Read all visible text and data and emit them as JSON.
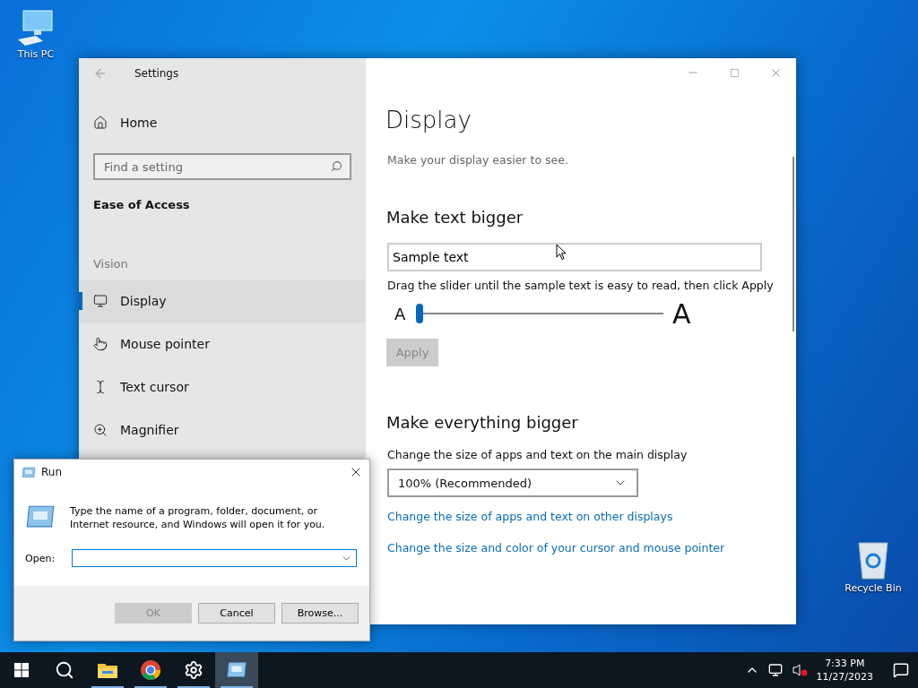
{
  "desktop_icons": [
    {
      "label": "This PC",
      "kind": "computer"
    },
    {
      "label": "Recycle Bin",
      "kind": "recycle"
    }
  ],
  "settings": {
    "title": "Settings",
    "home": "Home",
    "search": {
      "placeholder": "Find a setting"
    },
    "category": "Ease of Access",
    "group": "Vision",
    "nav": [
      {
        "label": "Display",
        "kind": "display",
        "selected": true
      },
      {
        "label": "Mouse pointer",
        "kind": "pointer",
        "selected": false
      },
      {
        "label": "Text cursor",
        "kind": "cursor",
        "selected": false
      },
      {
        "label": "Magnifier",
        "kind": "magnifier",
        "selected": false
      }
    ],
    "page": {
      "title": "Display",
      "subtitle": "Make your display easier to see.",
      "text_bigger": {
        "heading": "Make text bigger",
        "sample": "Sample text",
        "hint": "Drag the slider until the sample text is easy to read, then click Apply",
        "small_a": "A",
        "large_a": "A",
        "slider": {
          "level": 0
        },
        "apply": {
          "label": "Apply",
          "disabled": true
        }
      },
      "everything_bigger": {
        "heading": "Make everything bigger",
        "label": "Change the size of apps and text on the main display",
        "dropdown": "100% (Recommended)",
        "links": [
          "Change the size of apps and text on other displays",
          "Change the size and color of your cursor and mouse pointer"
        ]
      }
    }
  },
  "run_dialog": {
    "title": "Run",
    "message": "Type the name of a program, folder, document, or Internet resource, and Windows will open it for you.",
    "open_label": "Open:",
    "buttons": [
      {
        "label": "OK",
        "disabled": true
      },
      {
        "label": "Cancel",
        "disabled": false
      },
      {
        "label": "Browse...",
        "disabled": false
      }
    ]
  },
  "taskbar": {
    "apps": [
      {
        "kind": "start",
        "running": false,
        "selected": false
      },
      {
        "kind": "search",
        "running": false,
        "selected": false
      },
      {
        "kind": "explorer",
        "running": true,
        "selected": false
      },
      {
        "kind": "chrome",
        "running": true,
        "selected": false
      },
      {
        "kind": "settings",
        "running": true,
        "selected": false
      },
      {
        "kind": "run",
        "running": true,
        "selected": true
      }
    ],
    "time": "7:33 PM",
    "date": "11/27/2023"
  }
}
